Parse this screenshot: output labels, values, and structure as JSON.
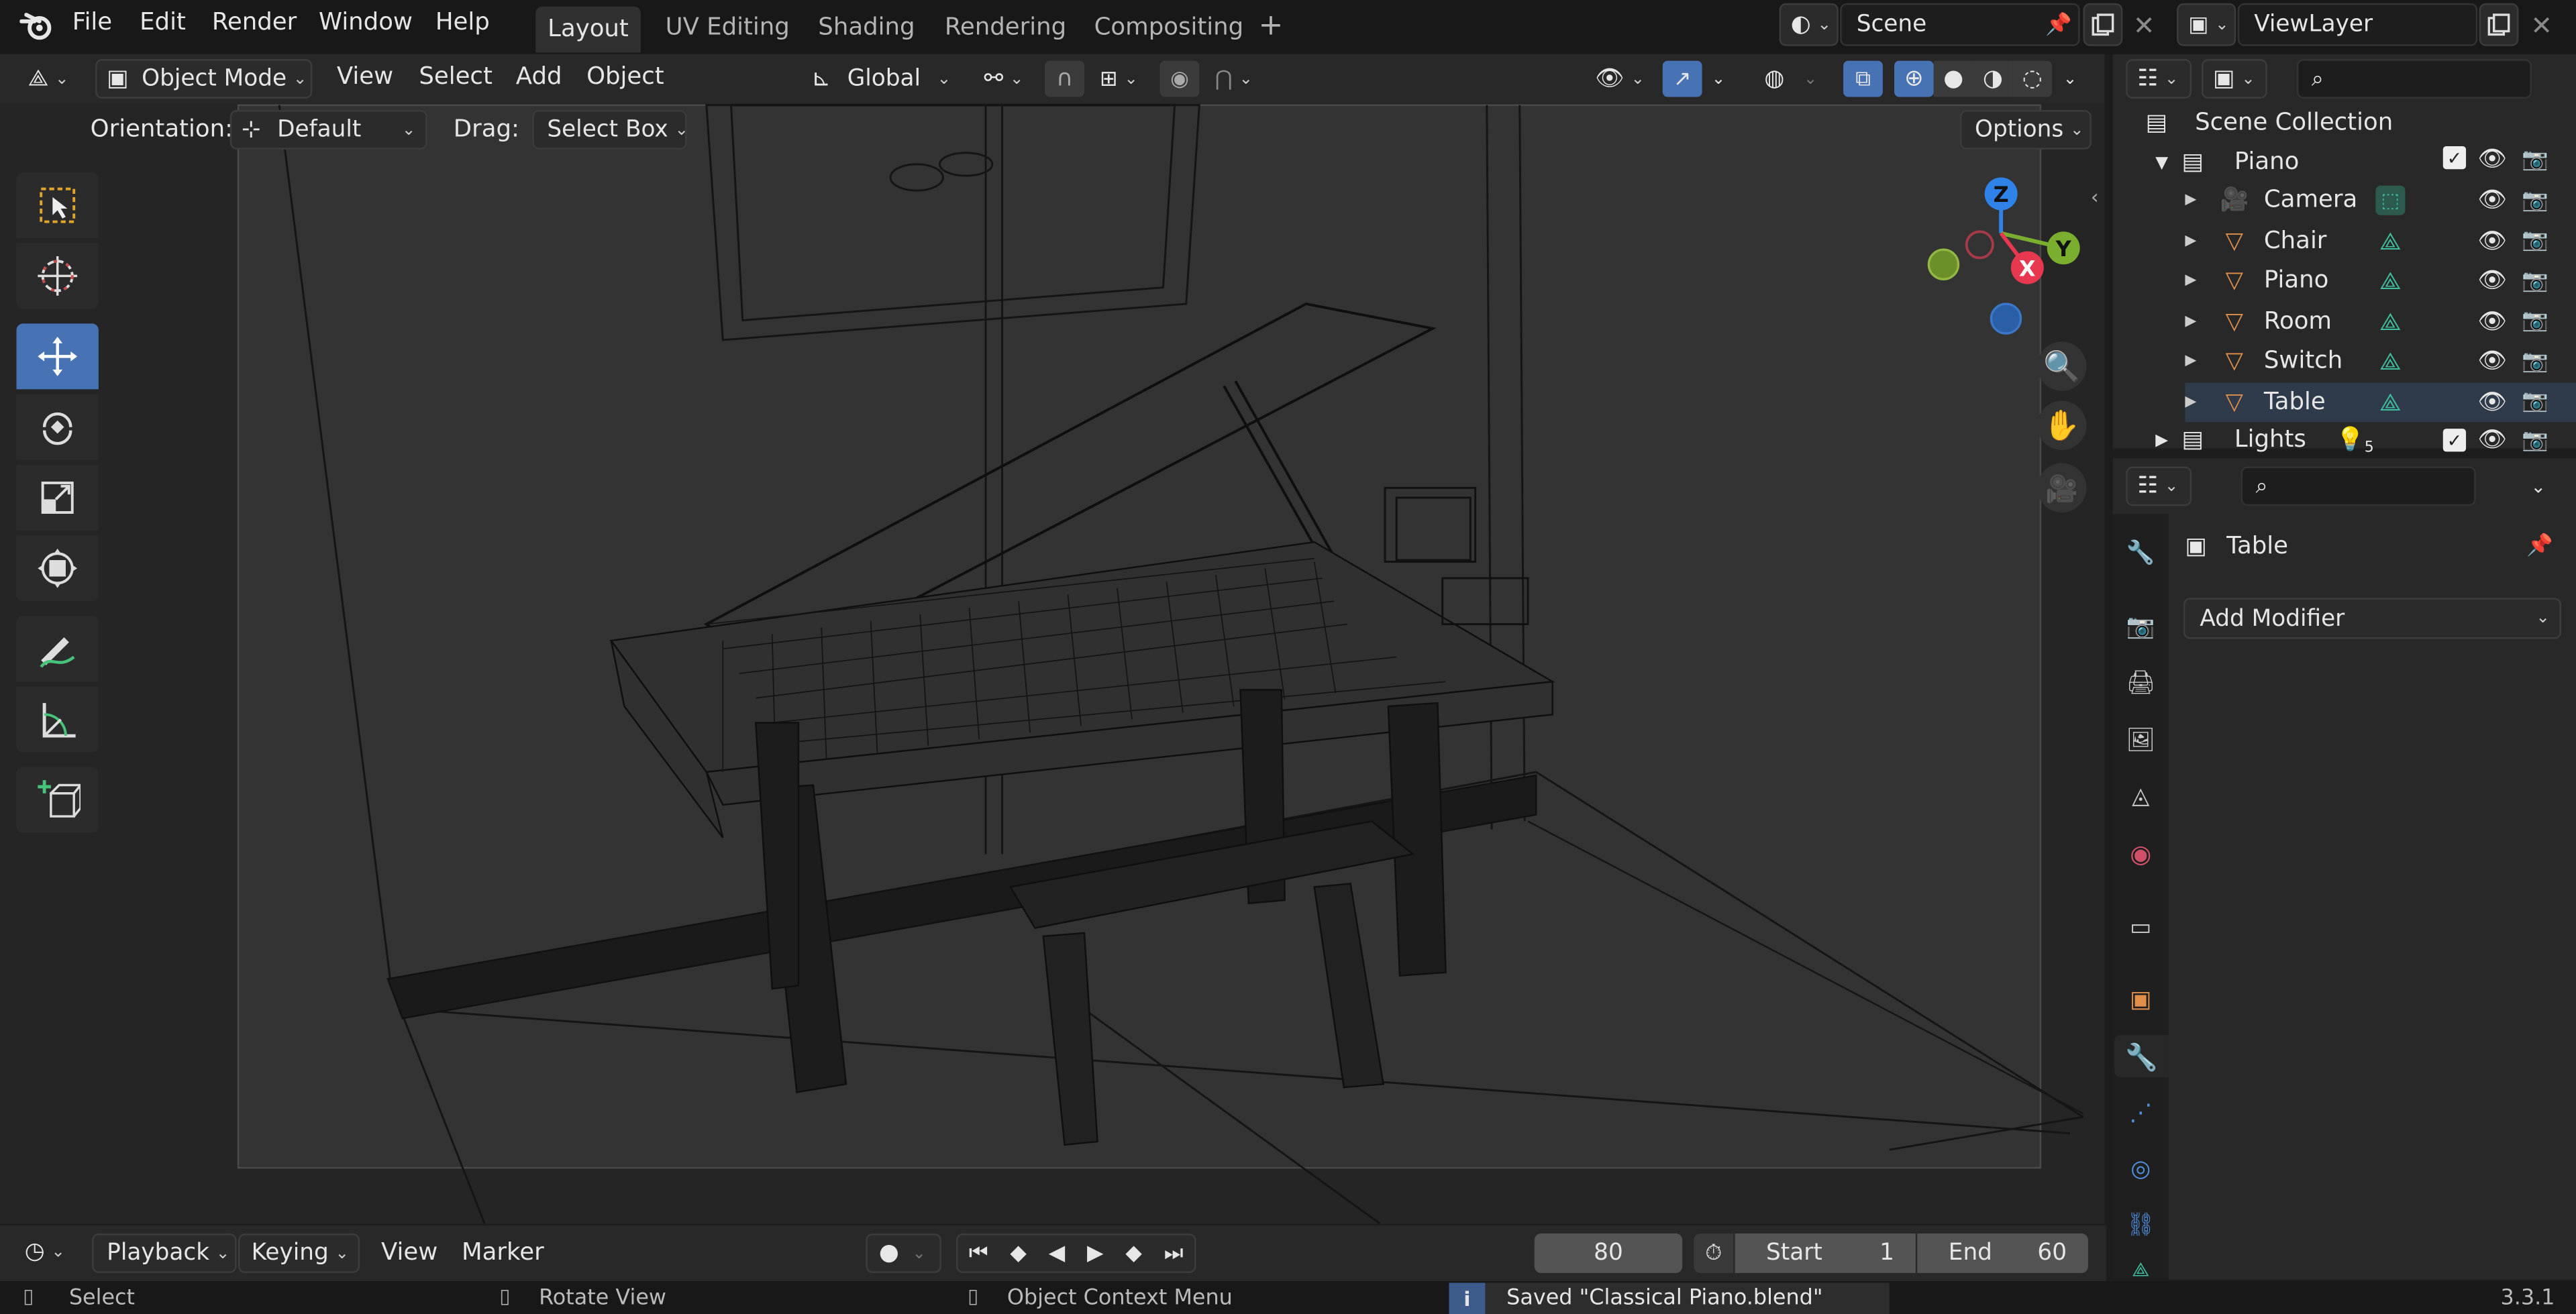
{
  "topbar": {
    "menus": [
      "File",
      "Edit",
      "Render",
      "Window",
      "Help"
    ],
    "workspace_tabs": [
      "Layout",
      "UV Editing",
      "Shading",
      "Rendering",
      "Compositing"
    ],
    "active_tab": "Layout",
    "add_tab": "+",
    "scene_name": "Scene",
    "view_layer": "ViewLayer"
  },
  "viewport_header": {
    "mode": "Object Mode",
    "menus": [
      "View",
      "Select",
      "Add",
      "Object"
    ],
    "transform_orientation": "Global"
  },
  "tool_settings": {
    "orientation_label": "Orientation:",
    "orientation_value": "Default",
    "drag_label": "Drag:",
    "drag_value": "Select Box",
    "options": "Options"
  },
  "gizmo": {
    "z": "Z",
    "y": "Y",
    "x": "X"
  },
  "outliner": {
    "scene_collection": "Scene Collection",
    "collection": "Piano",
    "objects": [
      {
        "name": "Camera",
        "type": "camera"
      },
      {
        "name": "Chair",
        "type": "mesh"
      },
      {
        "name": "Piano",
        "type": "mesh"
      },
      {
        "name": "Room",
        "type": "mesh"
      },
      {
        "name": "Switch",
        "type": "mesh"
      },
      {
        "name": "Table",
        "type": "mesh"
      }
    ],
    "lights_collection": "Lights",
    "lights_count": "5"
  },
  "properties": {
    "object_name": "Table",
    "add_modifier": "Add Modifier"
  },
  "timeline": {
    "menus": [
      "Playback",
      "Keying",
      "View",
      "Marker"
    ],
    "current_frame": "80",
    "start_label": "Start",
    "start": "1",
    "end_label": "End",
    "end": "60"
  },
  "statusbar": {
    "hint_left": "Select",
    "hint_middle": "Rotate View",
    "hint_right": "Object Context Menu",
    "message": "Saved \"Classical Piano.blend\"",
    "version": "3.3.1"
  },
  "colors": {
    "accent": "#4772b3",
    "object_orange": "#e08f4a",
    "mesh_green": "#3fbf9f",
    "axis_x": "#e8384f",
    "axis_y": "#7aae2f",
    "axis_z": "#2f83e8"
  }
}
